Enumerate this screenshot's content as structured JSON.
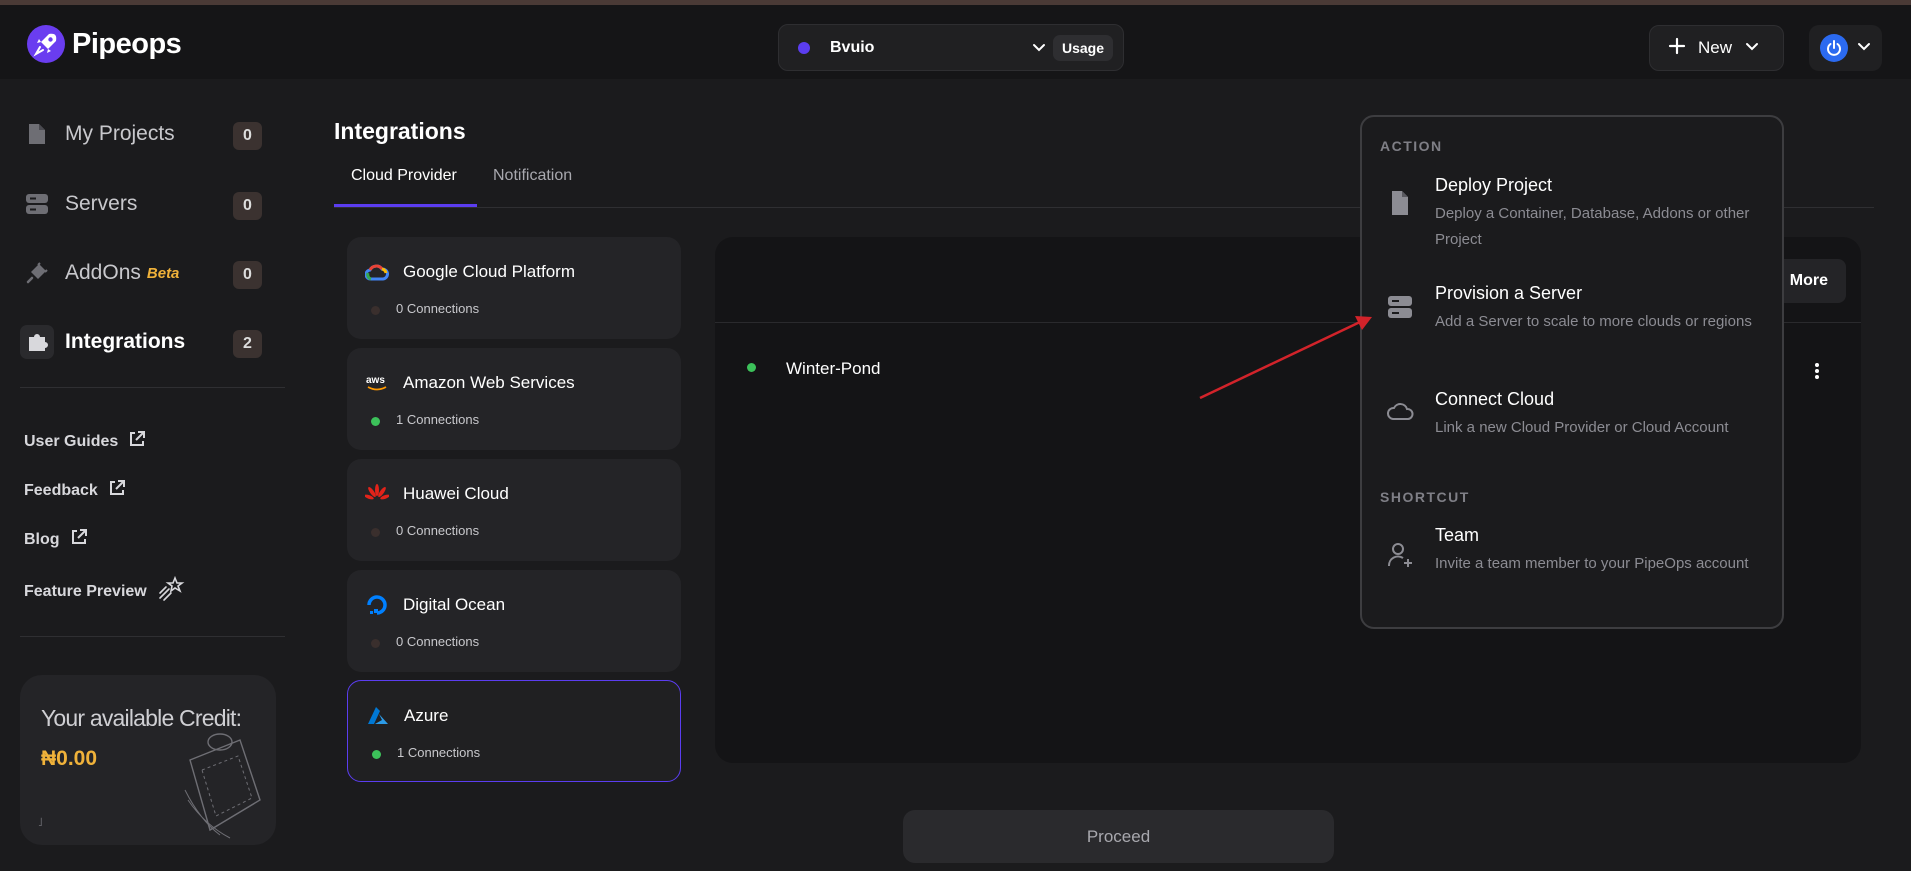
{
  "brand": {
    "name": "Pipeops"
  },
  "project_selector": {
    "name": "Bvuio",
    "usage_label": "Usage"
  },
  "header": {
    "new_label": "New"
  },
  "sidebar": {
    "items": [
      {
        "label": "My Projects",
        "count": "0"
      },
      {
        "label": "Servers",
        "count": "0"
      },
      {
        "label": "AddOns",
        "badge": "Beta",
        "count": "0"
      },
      {
        "label": "Integrations",
        "count": "2"
      }
    ],
    "links": [
      {
        "label": "User Guides"
      },
      {
        "label": "Feedback"
      },
      {
        "label": "Blog"
      },
      {
        "label": "Feature Preview"
      }
    ],
    "credit": {
      "title": "Your available Credit:",
      "amount": "₦0.00"
    }
  },
  "page": {
    "title": "Integrations",
    "tabs": [
      {
        "label": "Cloud Provider",
        "active": true
      },
      {
        "label": "Notification",
        "active": false
      }
    ]
  },
  "providers": [
    {
      "name": "Google Cloud Platform",
      "connections": "0 Connections",
      "status_color": "#3a2f2d"
    },
    {
      "name": "Amazon Web Services",
      "connections": "1 Connections",
      "status_color": "#3cc15a"
    },
    {
      "name": "Huawei Cloud",
      "connections": "0 Connections",
      "status_color": "#3a2f2d"
    },
    {
      "name": "Digital Ocean",
      "connections": "0 Connections",
      "status_color": "#3a2f2d"
    },
    {
      "name": "Azure",
      "connections": "1 Connections",
      "status_color": "#3cc15a"
    }
  ],
  "main": {
    "more_label": "More",
    "servers": [
      {
        "name": "Winter-Pond",
        "status_color": "#3cc15a"
      }
    ]
  },
  "proceed_label": "Proceed",
  "new_menu": {
    "action_heading": "ACTION",
    "shortcut_heading": "SHORTCUT",
    "items": [
      {
        "title": "Deploy Project",
        "desc": "Deploy a Container, Database, Addons or other Project",
        "icon": "file-icon"
      },
      {
        "title": "Provision a Server",
        "desc": "Add a Server to scale to more clouds or regions",
        "icon": "server-icon"
      },
      {
        "title": "Connect Cloud",
        "desc": "Link a new Cloud Provider or Cloud Account",
        "icon": "cloud-icon"
      },
      {
        "title": "Team",
        "desc": "Invite a team member to your PipeOps account",
        "icon": "user-plus-icon"
      }
    ]
  },
  "colors": {
    "accent": "#5b3df0",
    "credit": "#f0b23a",
    "annotation_arrow": "#d2232a"
  }
}
